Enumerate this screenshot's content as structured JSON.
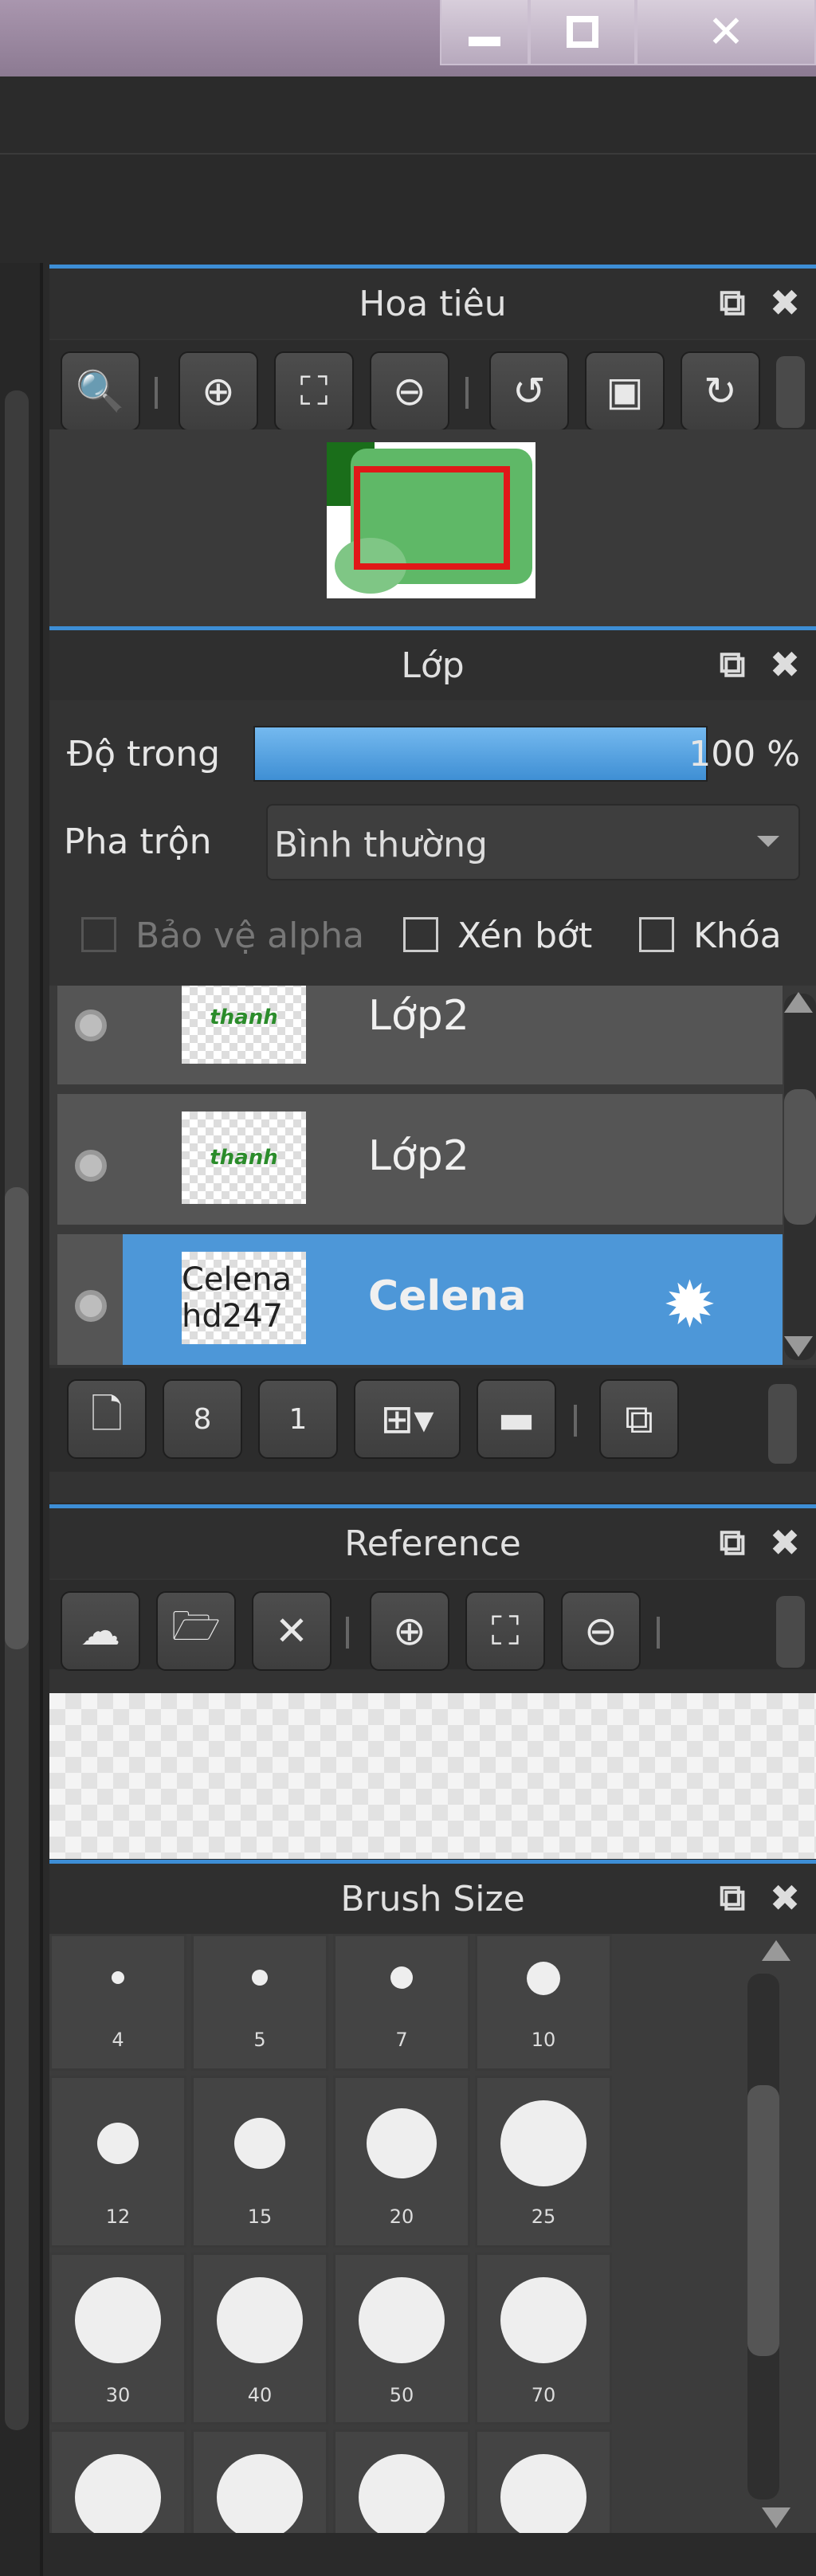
{
  "navigator": {
    "title": "Hoa tiêu"
  },
  "layers": {
    "title": "Lớp",
    "opacity_label": "Độ trong",
    "opacity_value": "100 %",
    "opacity_fraction": 1.0,
    "blend_label": "Pha trộn",
    "blend_value": "Bình thường",
    "protect_alpha": "Bảo vệ alpha",
    "clip": "Xén bớt",
    "lock": "Khóa",
    "items": [
      {
        "name": "Lớp2",
        "thumb_text": "thanh",
        "selected": false
      },
      {
        "name": "Lớp2",
        "thumb_text": "thanh",
        "selected": false
      },
      {
        "name": "Celena",
        "thumb_text": "Celena hd247",
        "selected": true
      }
    ]
  },
  "reference": {
    "title": "Reference"
  },
  "brush": {
    "title": "Brush Size",
    "sizes": [
      "4",
      "5",
      "7",
      "10",
      "12",
      "15",
      "20",
      "25",
      "30",
      "40",
      "50",
      "70"
    ]
  },
  "colors": {
    "accent": "#3d8ed6",
    "selected_row": "#4d97d8",
    "panel_bg": "#333333"
  }
}
